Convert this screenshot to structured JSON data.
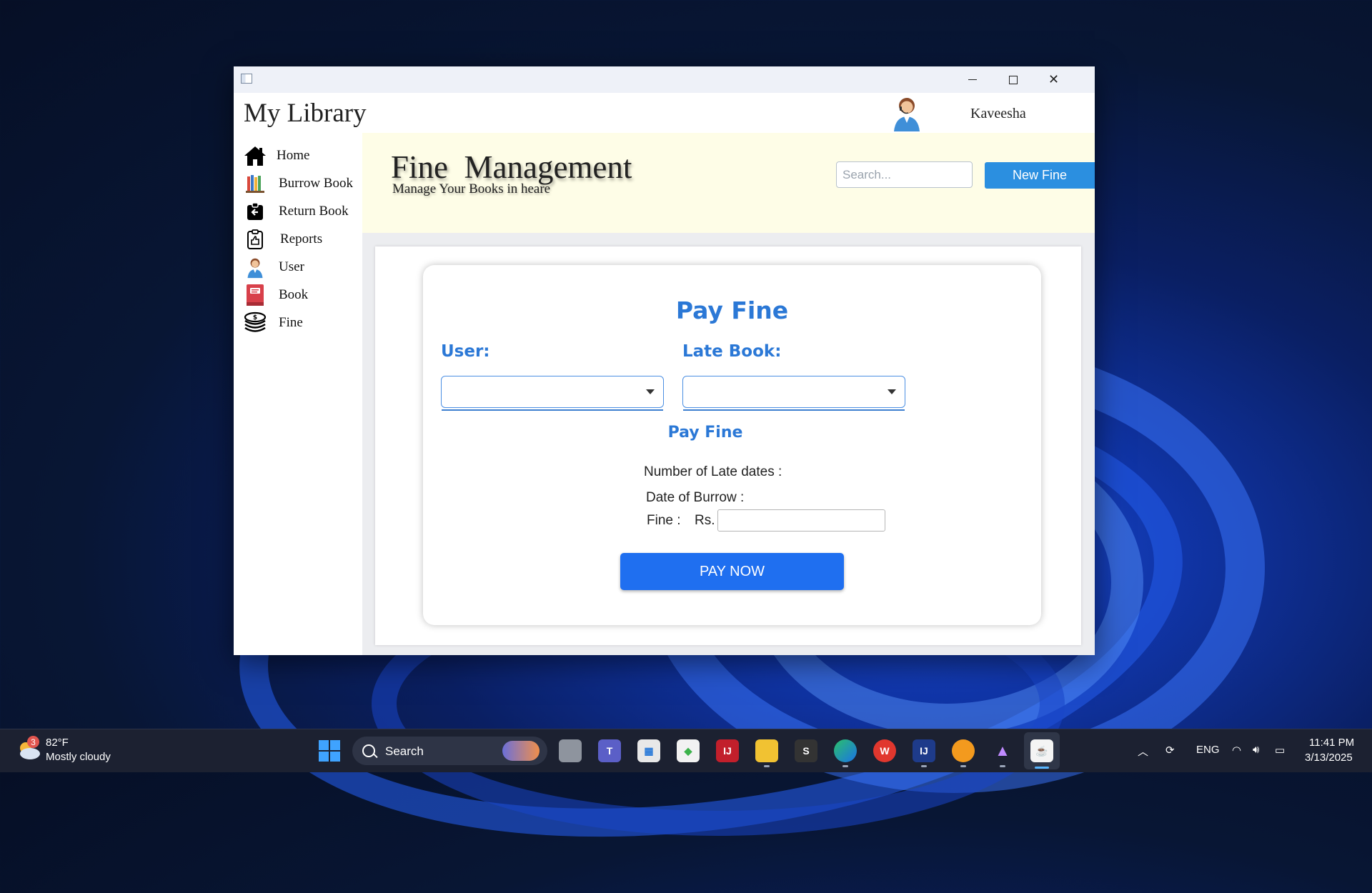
{
  "window": {
    "app_title": "My Library",
    "username": "Kaveesha"
  },
  "sidebar": {
    "items": [
      {
        "label": "Home",
        "icon": "home-icon"
      },
      {
        "label": "Burrow Book",
        "icon": "books-icon"
      },
      {
        "label": "Return Book",
        "icon": "return-icon"
      },
      {
        "label": "Reports",
        "icon": "reports-icon"
      },
      {
        "label": "User",
        "icon": "user-icon"
      },
      {
        "label": "Book",
        "icon": "book-icon"
      },
      {
        "label": "Fine",
        "icon": "coins-icon"
      }
    ]
  },
  "header": {
    "title": "Fine  Management",
    "subtitle": "Manage Your Books in heare",
    "search_placeholder": "Search...",
    "new_fine_label": "New Fine"
  },
  "form": {
    "title": "Pay Fine",
    "user_label": "User:",
    "late_book_label": "Late Book:",
    "user_value": "",
    "late_book_value": "",
    "section_title": "Pay Fine",
    "late_dates_label": "Number of Late dates :",
    "burrow_date_label": "Date of Burrow :",
    "fine_label": "Fine :",
    "currency_label": "Rs.",
    "fine_value": "",
    "pay_button_label": "PAY NOW"
  },
  "taskbar": {
    "weather_badge": "3",
    "weather_temp": "82°F",
    "weather_desc": "Mostly cloudy",
    "search_label": "Search",
    "language": "ENG",
    "time": "11:41 PM",
    "date": "3/13/2025"
  },
  "colors": {
    "accent_blue": "#2b78d6",
    "pay_button": "#1f6ff0",
    "new_fine_button": "#2b8fe0",
    "banner_bg": "#fefde7"
  }
}
